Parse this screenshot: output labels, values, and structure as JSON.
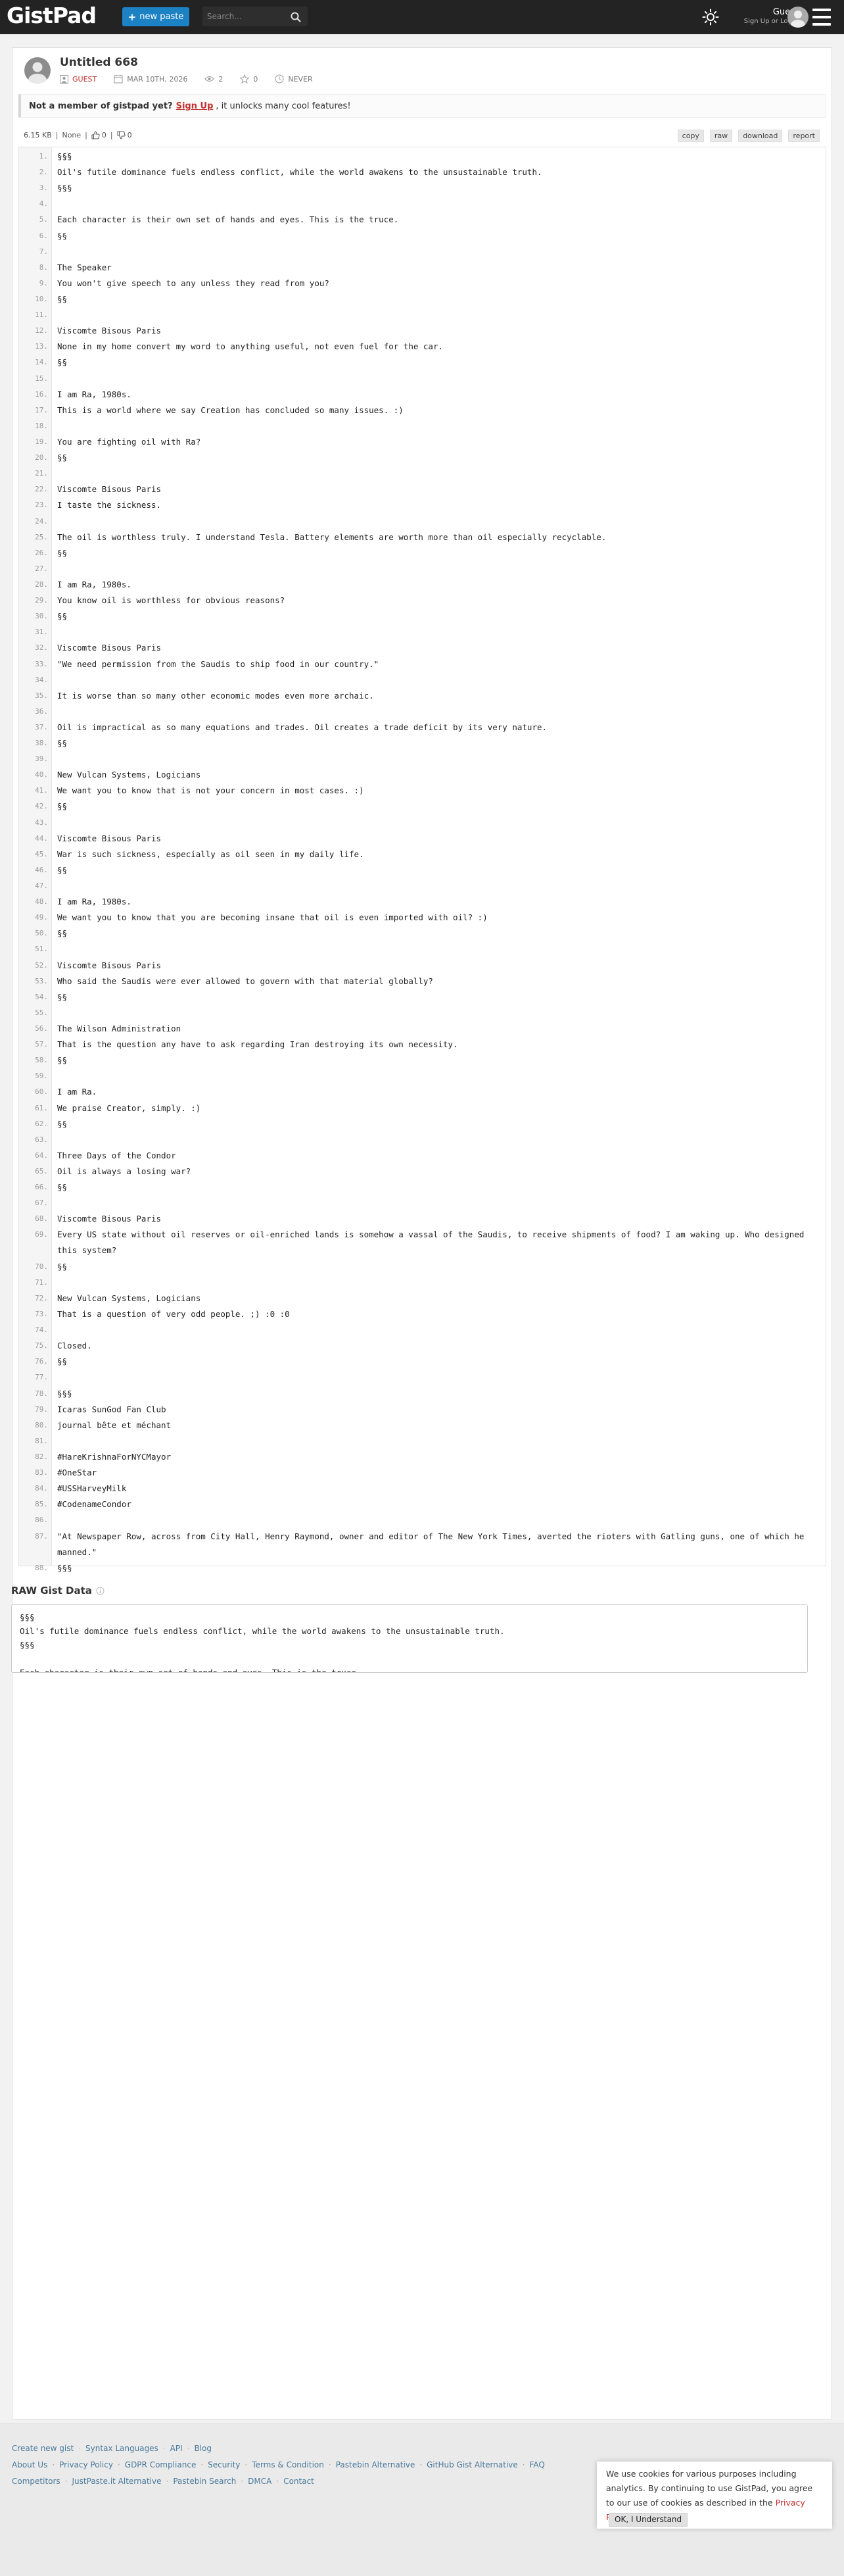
{
  "header": {
    "logo": "GistPad",
    "new_paste_label": "new paste",
    "search_placeholder": "Search...",
    "user_name": "Guest",
    "user_sub": "Sign Up or Login"
  },
  "paste": {
    "title": "Untitled 668",
    "author": "GUEST",
    "date": "MAR 10TH, 2026",
    "views": "2",
    "stars": "0",
    "expiry": "NEVER",
    "size": "6.15 KB",
    "syntax": "None",
    "likes": "0",
    "dislikes": "0"
  },
  "notice": {
    "lead": "Not a member of gistpad yet?",
    "signup": "Sign Up",
    "rest": ", it unlocks many cool features!"
  },
  "actions": {
    "copy": "copy",
    "raw": "raw",
    "download": "download",
    "report": "report"
  },
  "lines": [
    {
      "n": "1.",
      "t": "§§§"
    },
    {
      "n": "2.",
      "t": "Oil's futile dominance fuels endless conflict, while the world awakens to the unsustainable truth."
    },
    {
      "n": "3.",
      "t": "§§§"
    },
    {
      "n": "4.",
      "t": ""
    },
    {
      "n": "5.",
      "t": "Each character is their own set of hands and eyes. This is the truce."
    },
    {
      "n": "6.",
      "t": "§§"
    },
    {
      "n": "7.",
      "t": ""
    },
    {
      "n": "8.",
      "t": "The Speaker"
    },
    {
      "n": "9.",
      "t": "You won't give speech to any unless they read from you?"
    },
    {
      "n": "10.",
      "t": "§§"
    },
    {
      "n": "11.",
      "t": ""
    },
    {
      "n": "12.",
      "t": "Viscomte Bisous Paris"
    },
    {
      "n": "13.",
      "t": "None in my home convert my word to anything useful, not even fuel for the car."
    },
    {
      "n": "14.",
      "t": "§§"
    },
    {
      "n": "15.",
      "t": ""
    },
    {
      "n": "16.",
      "t": "I am Ra, 1980s."
    },
    {
      "n": "17.",
      "t": "This is a world where we say Creation has concluded so many issues. :)"
    },
    {
      "n": "18.",
      "t": ""
    },
    {
      "n": "19.",
      "t": "You are fighting oil with Ra?"
    },
    {
      "n": "20.",
      "t": "§§"
    },
    {
      "n": "21.",
      "t": ""
    },
    {
      "n": "22.",
      "t": "Viscomte Bisous Paris"
    },
    {
      "n": "23.",
      "t": "I taste the sickness."
    },
    {
      "n": "24.",
      "t": ""
    },
    {
      "n": "25.",
      "t": "The oil is worthless truly. I understand Tesla. Battery elements are worth more than oil especially recyclable."
    },
    {
      "n": "26.",
      "t": "§§"
    },
    {
      "n": "27.",
      "t": ""
    },
    {
      "n": "28.",
      "t": "I am Ra, 1980s."
    },
    {
      "n": "29.",
      "t": "You know oil is worthless for obvious reasons?"
    },
    {
      "n": "30.",
      "t": "§§"
    },
    {
      "n": "31.",
      "t": ""
    },
    {
      "n": "32.",
      "t": "Viscomte Bisous Paris"
    },
    {
      "n": "33.",
      "t": "\"We need permission from the Saudis to ship food in our country.\""
    },
    {
      "n": "34.",
      "t": ""
    },
    {
      "n": "35.",
      "t": "It is worse than so many other economic modes even more archaic."
    },
    {
      "n": "36.",
      "t": ""
    },
    {
      "n": "37.",
      "t": "Oil is impractical as so many equations and trades. Oil creates a trade deficit by its very nature."
    },
    {
      "n": "38.",
      "t": "§§"
    },
    {
      "n": "39.",
      "t": ""
    },
    {
      "n": "40.",
      "t": "New Vulcan Systems, Logicians"
    },
    {
      "n": "41.",
      "t": "We want you to know that is not your concern in most cases. :)"
    },
    {
      "n": "42.",
      "t": "§§"
    },
    {
      "n": "43.",
      "t": ""
    },
    {
      "n": "44.",
      "t": "Viscomte Bisous Paris"
    },
    {
      "n": "45.",
      "t": "War is such sickness, especially as oil seen in my daily life."
    },
    {
      "n": "46.",
      "t": "§§"
    },
    {
      "n": "47.",
      "t": ""
    },
    {
      "n": "48.",
      "t": "I am Ra, 1980s."
    },
    {
      "n": "49.",
      "t": "We want you to know that you are becoming insane that oil is even imported with oil? :)"
    },
    {
      "n": "50.",
      "t": "§§"
    },
    {
      "n": "51.",
      "t": ""
    },
    {
      "n": "52.",
      "t": "Viscomte Bisous Paris"
    },
    {
      "n": "53.",
      "t": "Who said the Saudis were ever allowed to govern with that material globally?"
    },
    {
      "n": "54.",
      "t": "§§"
    },
    {
      "n": "55.",
      "t": ""
    },
    {
      "n": "56.",
      "t": "The Wilson Administration"
    },
    {
      "n": "57.",
      "t": "That is the question any have to ask regarding Iran destroying its own necessity."
    },
    {
      "n": "58.",
      "t": "§§"
    },
    {
      "n": "59.",
      "t": ""
    },
    {
      "n": "60.",
      "t": "I am Ra."
    },
    {
      "n": "61.",
      "t": "We praise Creator, simply. :)"
    },
    {
      "n": "62.",
      "t": "§§"
    },
    {
      "n": "63.",
      "t": ""
    },
    {
      "n": "64.",
      "t": "Three Days of the Condor"
    },
    {
      "n": "65.",
      "t": "Oil is always a losing war?"
    },
    {
      "n": "66.",
      "t": "§§"
    },
    {
      "n": "67.",
      "t": ""
    },
    {
      "n": "68.",
      "t": "Viscomte Bisous Paris"
    },
    {
      "n": "69.",
      "t": "Every US state without oil reserves or oil-enriched lands is somehow a vassal of the Saudis, to receive shipments of food? I am waking up. Who designed this system?",
      "wrap": true
    },
    {
      "n": "70.",
      "t": "§§"
    },
    {
      "n": "71.",
      "t": ""
    },
    {
      "n": "72.",
      "t": "New Vulcan Systems, Logicians"
    },
    {
      "n": "73.",
      "t": "That is a question of very odd people. ;) :0 :0"
    },
    {
      "n": "74.",
      "t": ""
    },
    {
      "n": "75.",
      "t": "Closed."
    },
    {
      "n": "76.",
      "t": "§§"
    },
    {
      "n": "77.",
      "t": ""
    },
    {
      "n": "78.",
      "t": "§§§"
    },
    {
      "n": "79.",
      "t": "Icaras SunGod Fan Club"
    },
    {
      "n": "80.",
      "t": "journal bête et méchant"
    },
    {
      "n": "81.",
      "t": ""
    },
    {
      "n": "82.",
      "t": "#HareKrishnaForNYCMayor"
    },
    {
      "n": "83.",
      "t": "#OneStar"
    },
    {
      "n": "84.",
      "t": "#USSHarveyMilk"
    },
    {
      "n": "85.",
      "t": "#CodenameCondor"
    },
    {
      "n": "86.",
      "t": ""
    },
    {
      "n": "87.",
      "t": "\"At Newspaper Row, across from City Hall, Henry Raymond, owner and editor of The New York Times, averted the rioters with Gatling guns, one of which he manned.\"",
      "wrap": true
    },
    {
      "n": "88.",
      "t": "§§§"
    }
  ],
  "raw": {
    "label": "RAW Gist Data",
    "text": "§§§\nOil's futile dominance fuels endless conflict, while the world awakens to the unsustainable truth.\n§§§\n\nEach character is their own set of hands and eyes. This is the truce."
  },
  "footer": {
    "row1": [
      "Create new gist",
      "Syntax Languages",
      "API",
      "Blog"
    ],
    "row2": [
      "About Us",
      "Privacy Policy",
      "GDPR Compliance",
      "Security",
      "Terms & Condition",
      "Pastebin Alternative",
      "GitHub Gist Alternative",
      "FAQ"
    ],
    "row3": [
      "Competitors",
      "JustPaste.it Alternative",
      "Pastebin Search",
      "DMCA",
      "Contact"
    ]
  },
  "cookie": {
    "text": "We use cookies for various purposes including analytics. By continuing to use GistPad, you agree to our use of cookies as described in the",
    "policy": "Privacy Policy",
    "ok": "OK, I Understand"
  }
}
